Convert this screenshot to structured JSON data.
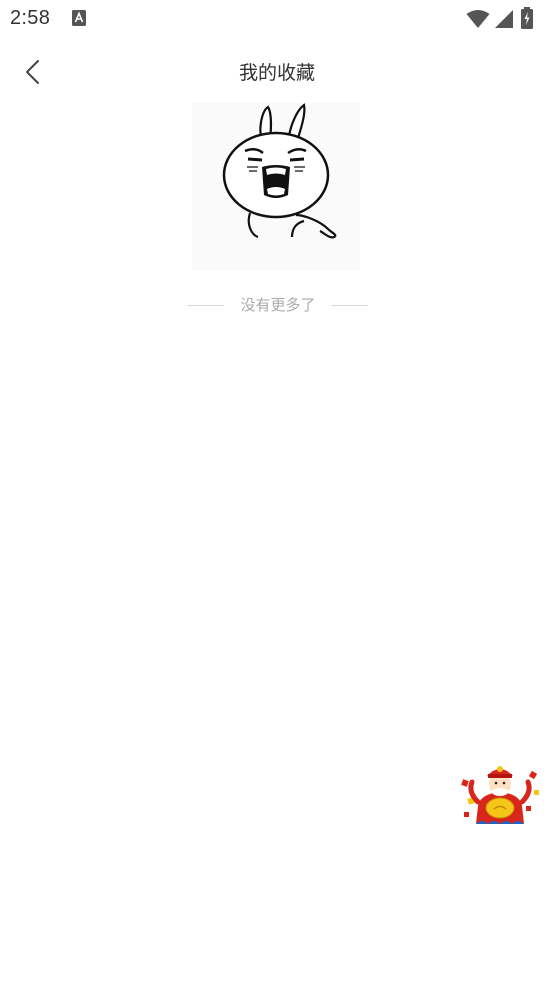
{
  "status_bar": {
    "time": "2:58"
  },
  "header": {
    "title": "我的收藏"
  },
  "list": {
    "end_text": "没有更多了"
  },
  "colors": {
    "background": "#ffffff",
    "title_text": "#333333",
    "muted_text": "#aaaaaa",
    "promo_red": "#d9261c",
    "promo_gold": "#f5c518"
  }
}
